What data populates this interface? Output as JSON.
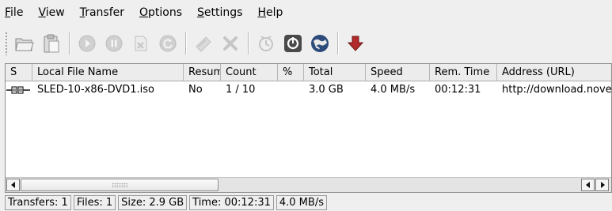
{
  "menu": {
    "items": [
      {
        "label": "File",
        "mnemonic": "F",
        "rest": "ile"
      },
      {
        "label": "View",
        "mnemonic": "V",
        "rest": "iew"
      },
      {
        "label": "Transfer",
        "mnemonic": "T",
        "rest": "ransfer"
      },
      {
        "label": "Options",
        "mnemonic": "O",
        "rest": "ptions"
      },
      {
        "label": "Settings",
        "mnemonic": "S",
        "rest": "ettings"
      },
      {
        "label": "Help",
        "mnemonic": "H",
        "rest": "elp"
      }
    ]
  },
  "toolbar": {
    "icons": [
      "open-icon",
      "paste-icon",
      "resume-icon",
      "pause-icon",
      "delete-icon",
      "restart-icon",
      "queue-icon",
      "cancel-icon",
      "timer-icon",
      "offline-mode-icon",
      "drop-target-icon",
      "download-icon"
    ]
  },
  "table": {
    "headers": [
      "S",
      "Local File Name",
      "Resume",
      "Count",
      "%",
      "Total",
      "Speed",
      "Rem. Time",
      "Address (URL)"
    ],
    "rows": [
      {
        "status_icon": "connection-plug-icon",
        "name": "SLED-10-x86-DVD1.iso",
        "resume": "No",
        "count": "1 / 10",
        "percent": "",
        "total": "3.0 GB",
        "speed": "4.0 MB/s",
        "remaining": "00:12:31",
        "url": "http://download.novell"
      }
    ]
  },
  "status": {
    "transfers": "Transfers: 1",
    "files": "Files: 1",
    "size": "Size: 2.9 GB",
    "time": "Time: 00:12:31",
    "speed": "4.0 MB/s"
  },
  "colors": {
    "background": "#efefef",
    "toolbar_disabled": "#c7c7c7",
    "offline_icon": "#4a4a4a",
    "globe": "#2c4a7a",
    "download_arrow": "#b32a2a"
  }
}
